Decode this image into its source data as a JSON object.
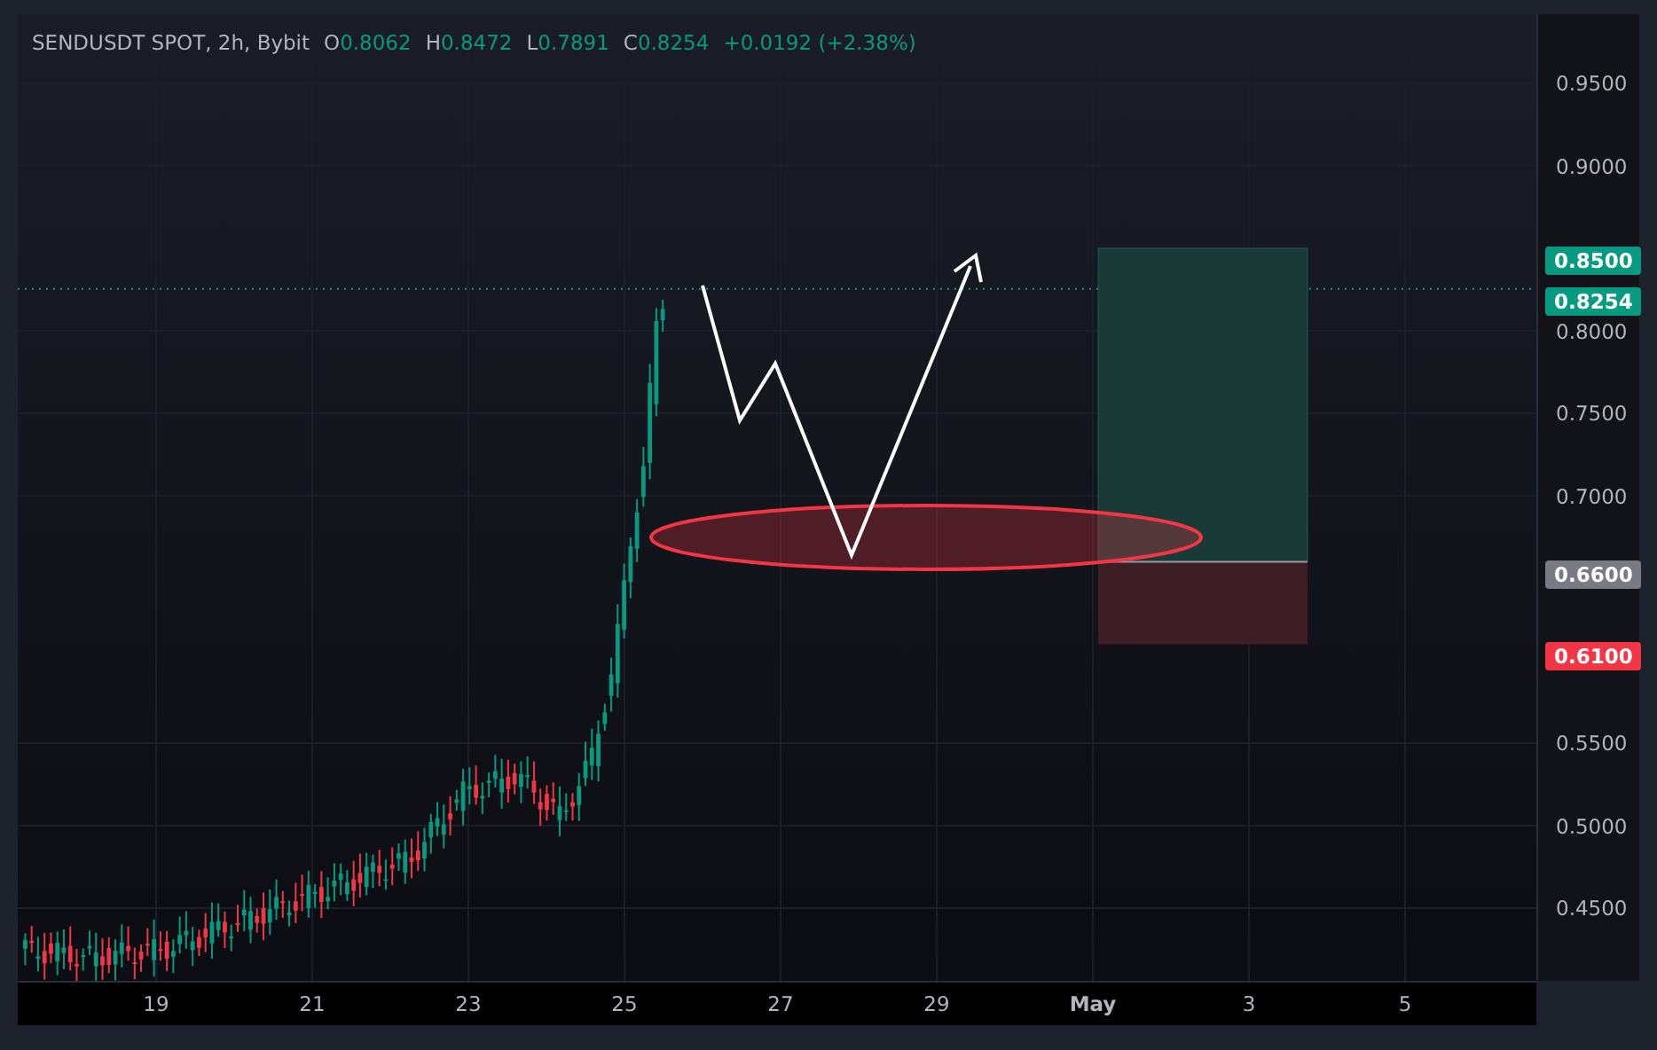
{
  "legend": {
    "symbol": "SENDUSDT SPOT, 2h, Bybit",
    "ohlc": [
      {
        "key": "O",
        "value": "0.8062"
      },
      {
        "key": "H",
        "value": "0.8472"
      },
      {
        "key": "L",
        "value": "0.7891"
      },
      {
        "key": "C",
        "value": "0.8254"
      }
    ],
    "change": "+0.0192 (+2.38%)"
  },
  "price_axis": [
    "0.9500",
    "0.9000",
    "0.8000",
    "0.7500",
    "0.7000",
    "0.5500",
    "0.5000",
    "0.4500"
  ],
  "price_tags": [
    {
      "label": "0.8500",
      "kind": "take-profit",
      "color": "#089981"
    },
    {
      "label": "0.8254",
      "kind": "last",
      "color": "#089981"
    },
    {
      "label": "0.6600",
      "kind": "entry",
      "color": "#787b86"
    },
    {
      "label": "0.6100",
      "kind": "stop",
      "color": "#f23645"
    }
  ],
  "time_axis": [
    "19",
    "21",
    "23",
    "25",
    "27",
    "29",
    "May",
    "3",
    "5"
  ]
}
